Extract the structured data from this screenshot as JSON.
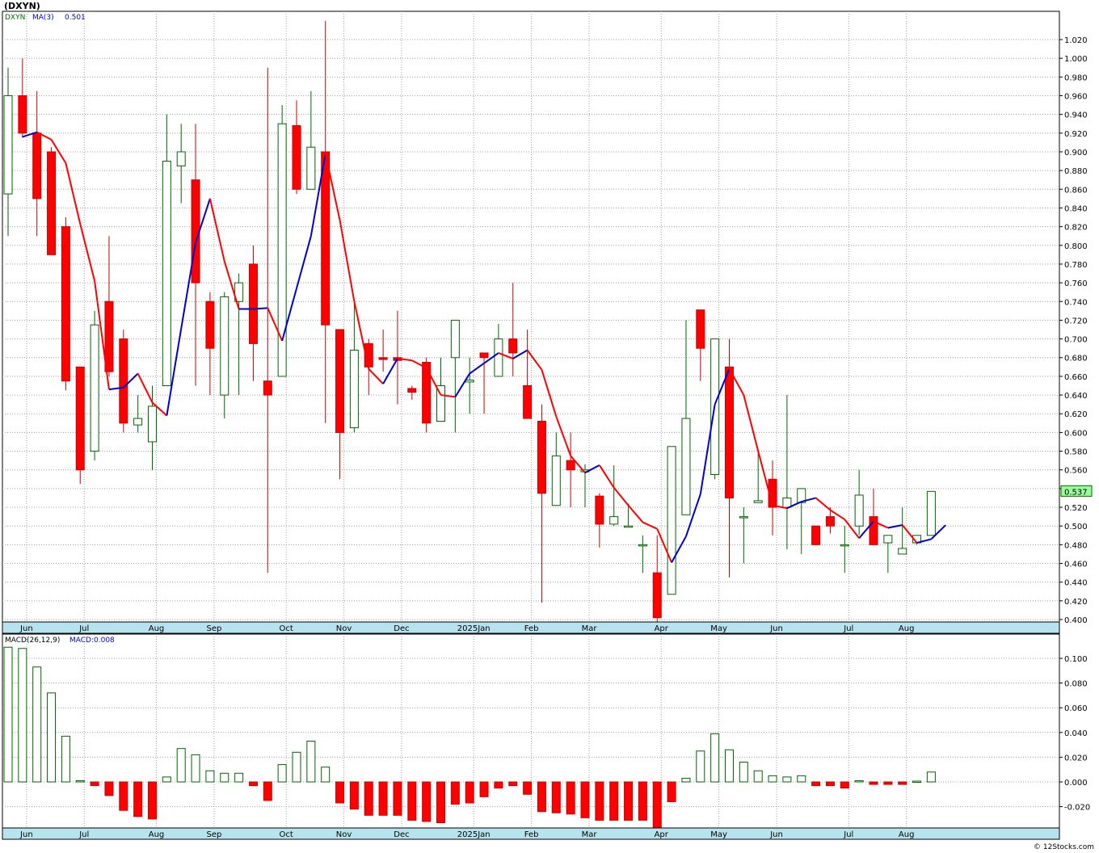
{
  "title": "(DXYN)",
  "footer": "© 12Stocks.com",
  "colors": {
    "up": "#006600",
    "down": "#cc0000",
    "down_fill": "#ff0000",
    "ma_up": "#0000cc",
    "ma_down": "#ff0000",
    "axis_bar": "#b7e3ef",
    "grid": "#a0a0a0"
  },
  "price_panel": {
    "legend": {
      "symbol": "DXYN",
      "ma_label": "MA(3)",
      "ma_value": "0.501"
    },
    "last_price_label": "0.537",
    "y_ticks": [
      "1.020",
      "1.000",
      "0.980",
      "0.960",
      "0.940",
      "0.920",
      "0.900",
      "0.880",
      "0.860",
      "0.840",
      "0.820",
      "0.800",
      "0.780",
      "0.760",
      "0.740",
      "0.720",
      "0.700",
      "0.680",
      "0.660",
      "0.640",
      "0.620",
      "0.600",
      "0.580",
      "0.560",
      "0.540",
      "0.520",
      "0.500",
      "0.480",
      "0.460",
      "0.440",
      "0.420",
      "0.400"
    ]
  },
  "macd_panel": {
    "legend": {
      "label": "MACD(26,12,9)",
      "value_label": "MACD:0.008"
    },
    "y_ticks": [
      "0.100",
      "0.080",
      "0.060",
      "0.040",
      "0.020",
      "0.000",
      "-0.020"
    ]
  },
  "x_axis": {
    "months": [
      "Jun",
      "Jul",
      "Aug",
      "Sep",
      "Oct",
      "Nov",
      "Dec",
      "2025Jan",
      "Feb",
      "Mar",
      "Apr",
      "May",
      "Jun",
      "Jul",
      "Aug"
    ]
  },
  "chart_data": [
    {
      "type": "candlestick",
      "title": "(DXYN)",
      "ylim": [
        0.38,
        1.04
      ],
      "series": [
        {
          "name": "DXYN",
          "candles": [
            {
              "o": 0.855,
              "h": 0.99,
              "l": 0.81,
              "c": 0.96
            },
            {
              "o": 0.96,
              "h": 1.0,
              "l": 0.915,
              "c": 0.92
            },
            {
              "o": 0.92,
              "h": 0.965,
              "l": 0.81,
              "c": 0.85
            },
            {
              "o": 0.9,
              "h": 0.905,
              "l": 0.79,
              "c": 0.79
            },
            {
              "o": 0.82,
              "h": 0.83,
              "l": 0.645,
              "c": 0.655
            },
            {
              "o": 0.67,
              "h": 0.67,
              "l": 0.545,
              "c": 0.56
            },
            {
              "o": 0.58,
              "h": 0.73,
              "l": 0.57,
              "c": 0.715
            },
            {
              "o": 0.74,
              "h": 0.81,
              "l": 0.66,
              "c": 0.665
            },
            {
              "o": 0.7,
              "h": 0.71,
              "l": 0.6,
              "c": 0.61
            },
            {
              "o": 0.608,
              "h": 0.64,
              "l": 0.6,
              "c": 0.615
            },
            {
              "o": 0.59,
              "h": 0.65,
              "l": 0.56,
              "c": 0.628
            },
            {
              "o": 0.65,
              "h": 0.94,
              "l": 0.65,
              "c": 0.89
            },
            {
              "o": 0.885,
              "h": 0.93,
              "l": 0.845,
              "c": 0.9
            },
            {
              "o": 0.87,
              "h": 0.93,
              "l": 0.65,
              "c": 0.76
            },
            {
              "o": 0.74,
              "h": 0.75,
              "l": 0.64,
              "c": 0.69
            },
            {
              "o": 0.64,
              "h": 0.75,
              "l": 0.615,
              "c": 0.745
            },
            {
              "o": 0.74,
              "h": 0.77,
              "l": 0.64,
              "c": 0.76
            },
            {
              "o": 0.78,
              "h": 0.8,
              "l": 0.655,
              "c": 0.695
            },
            {
              "o": 0.655,
              "h": 0.99,
              "l": 0.45,
              "c": 0.64
            },
            {
              "o": 0.66,
              "h": 0.95,
              "l": 0.66,
              "c": 0.93
            },
            {
              "o": 0.928,
              "h": 0.955,
              "l": 0.855,
              "c": 0.86
            },
            {
              "o": 0.86,
              "h": 0.965,
              "l": 0.86,
              "c": 0.905
            },
            {
              "o": 0.9,
              "h": 1.04,
              "l": 0.61,
              "c": 0.715
            },
            {
              "o": 0.71,
              "h": 0.71,
              "l": 0.55,
              "c": 0.6
            },
            {
              "o": 0.605,
              "h": 0.74,
              "l": 0.6,
              "c": 0.688
            },
            {
              "o": 0.695,
              "h": 0.7,
              "l": 0.64,
              "c": 0.67
            },
            {
              "o": 0.68,
              "h": 0.71,
              "l": 0.665,
              "c": 0.678
            },
            {
              "o": 0.68,
              "h": 0.73,
              "l": 0.63,
              "c": 0.677
            },
            {
              "o": 0.647,
              "h": 0.65,
              "l": 0.635,
              "c": 0.643
            },
            {
              "o": 0.675,
              "h": 0.68,
              "l": 0.6,
              "c": 0.61
            },
            {
              "o": 0.612,
              "h": 0.68,
              "l": 0.612,
              "c": 0.65
            },
            {
              "o": 0.68,
              "h": 0.72,
              "l": 0.6,
              "c": 0.72
            },
            {
              "o": 0.654,
              "h": 0.68,
              "l": 0.62,
              "c": 0.656
            },
            {
              "o": 0.685,
              "h": 0.685,
              "l": 0.62,
              "c": 0.68
            },
            {
              "o": 0.66,
              "h": 0.716,
              "l": 0.66,
              "c": 0.7
            },
            {
              "o": 0.7,
              "h": 0.76,
              "l": 0.66,
              "c": 0.685
            },
            {
              "o": 0.65,
              "h": 0.71,
              "l": 0.615,
              "c": 0.615
            },
            {
              "o": 0.612,
              "h": 0.63,
              "l": 0.418,
              "c": 0.535
            },
            {
              "o": 0.522,
              "h": 0.6,
              "l": 0.522,
              "c": 0.575
            },
            {
              "o": 0.57,
              "h": 0.6,
              "l": 0.52,
              "c": 0.56
            },
            {
              "o": 0.558,
              "h": 0.566,
              "l": 0.52,
              "c": 0.56
            },
            {
              "o": 0.532,
              "h": 0.535,
              "l": 0.477,
              "c": 0.502
            },
            {
              "o": 0.502,
              "h": 0.565,
              "l": 0.5,
              "c": 0.51
            },
            {
              "o": 0.5,
              "h": 0.524,
              "l": 0.5,
              "c": 0.5
            },
            {
              "o": 0.48,
              "h": 0.49,
              "l": 0.45,
              "c": 0.48
            },
            {
              "o": 0.45,
              "h": 0.49,
              "l": 0.38,
              "c": 0.402
            },
            {
              "o": 0.427,
              "h": 0.585,
              "l": 0.427,
              "c": 0.585
            },
            {
              "o": 0.512,
              "h": 0.72,
              "l": 0.512,
              "c": 0.615
            },
            {
              "o": 0.731,
              "h": 0.731,
              "l": 0.655,
              "c": 0.69
            },
            {
              "o": 0.555,
              "h": 0.7,
              "l": 0.55,
              "c": 0.7
            },
            {
              "o": 0.67,
              "h": 0.7,
              "l": 0.445,
              "c": 0.53
            },
            {
              "o": 0.51,
              "h": 0.52,
              "l": 0.46,
              "c": 0.51
            },
            {
              "o": 0.525,
              "h": 0.58,
              "l": 0.525,
              "c": 0.527
            },
            {
              "o": 0.55,
              "h": 0.57,
              "l": 0.49,
              "c": 0.52
            },
            {
              "o": 0.52,
              "h": 0.64,
              "l": 0.475,
              "c": 0.53
            },
            {
              "o": 0.525,
              "h": 0.54,
              "l": 0.47,
              "c": 0.54
            },
            {
              "o": 0.5,
              "h": 0.5,
              "l": 0.48,
              "c": 0.48
            },
            {
              "o": 0.51,
              "h": 0.52,
              "l": 0.492,
              "c": 0.5
            },
            {
              "o": 0.48,
              "h": 0.5,
              "l": 0.45,
              "c": 0.48
            },
            {
              "o": 0.5,
              "h": 0.56,
              "l": 0.49,
              "c": 0.533
            },
            {
              "o": 0.51,
              "h": 0.54,
              "l": 0.48,
              "c": 0.48
            },
            {
              "o": 0.482,
              "h": 0.49,
              "l": 0.45,
              "c": 0.49
            },
            {
              "o": 0.47,
              "h": 0.52,
              "l": 0.47,
              "c": 0.476
            },
            {
              "o": 0.482,
              "h": 0.49,
              "l": 0.48,
              "c": 0.49
            },
            {
              "o": 0.49,
              "h": 0.537,
              "l": 0.49,
              "c": 0.537
            }
          ]
        },
        {
          "name": "MA(3)",
          "values": [
            0.916,
            0.921,
            0.913,
            0.888,
            0.823,
            0.762,
            0.646,
            0.648,
            0.663,
            0.632,
            0.618,
            0.711,
            0.803,
            0.85,
            0.783,
            0.732,
            0.732,
            0.733,
            0.698,
            0.754,
            0.81,
            0.898,
            0.827,
            0.74,
            0.668,
            0.652,
            0.679,
            0.677,
            0.669,
            0.64,
            0.638,
            0.663,
            0.674,
            0.685,
            0.679,
            0.688,
            0.667,
            0.617,
            0.575,
            0.557,
            0.565,
            0.541,
            0.522,
            0.504,
            0.497,
            0.461,
            0.489,
            0.534,
            0.63,
            0.668,
            0.64,
            0.58,
            0.522,
            0.519,
            0.526,
            0.53,
            0.517,
            0.507,
            0.487,
            0.505,
            0.498,
            0.501,
            0.482,
            0.486,
            0.501
          ]
        }
      ]
    },
    {
      "type": "bar",
      "title": "MACD(26,12,9)",
      "ylim": [
        -0.038,
        0.112
      ],
      "series": [
        {
          "name": "MACD",
          "values": [
            0.109,
            0.108,
            0.093,
            0.072,
            0.037,
            0.001,
            -0.003,
            -0.011,
            -0.023,
            -0.028,
            -0.03,
            0.004,
            0.027,
            0.022,
            0.009,
            0.007,
            0.007,
            -0.003,
            -0.015,
            0.014,
            0.024,
            0.033,
            0.012,
            -0.017,
            -0.022,
            -0.027,
            -0.027,
            -0.027,
            -0.031,
            -0.032,
            -0.033,
            -0.018,
            -0.017,
            -0.012,
            -0.005,
            -0.003,
            -0.01,
            -0.024,
            -0.025,
            -0.026,
            -0.029,
            -0.031,
            -0.031,
            -0.031,
            -0.031,
            -0.038,
            -0.016,
            0.003,
            0.025,
            0.039,
            0.026,
            0.016,
            0.009,
            0.005,
            0.004,
            0.005,
            -0.003,
            -0.003,
            -0.005,
            0.001,
            -0.002,
            -0.002,
            -0.002,
            0.0,
            0.008
          ]
        }
      ]
    }
  ]
}
